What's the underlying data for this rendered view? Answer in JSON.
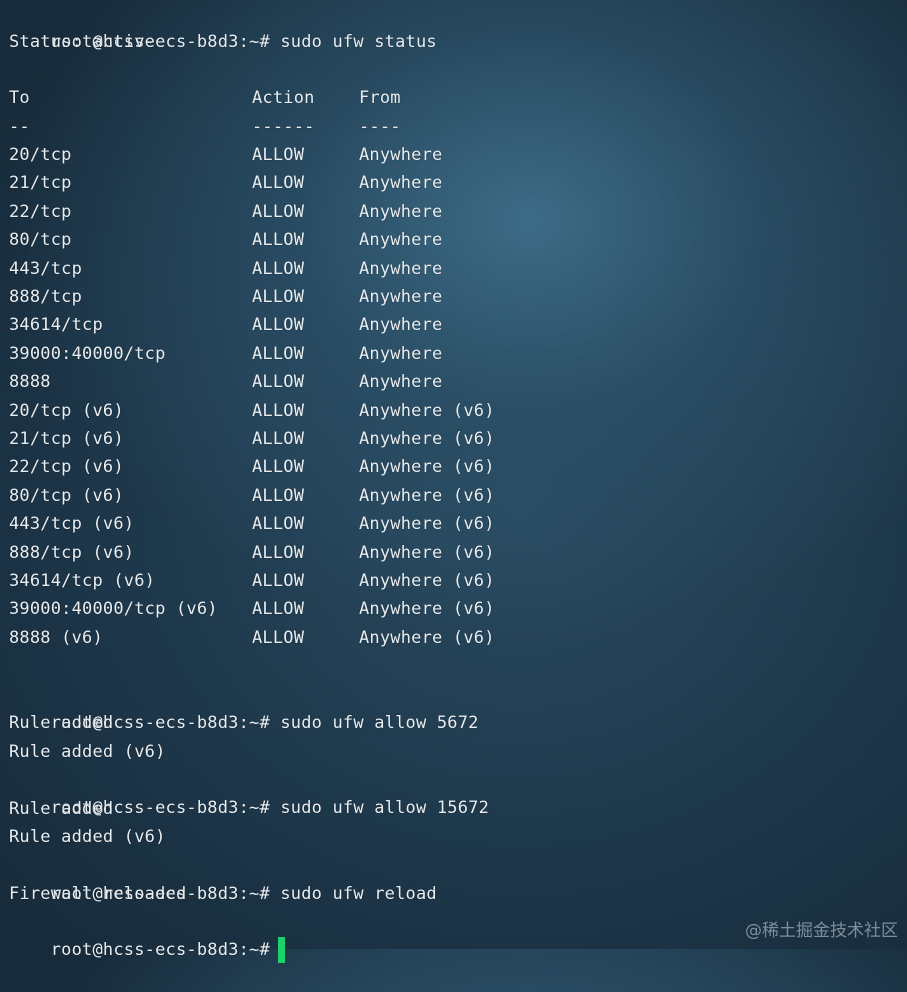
{
  "terminal": {
    "prompt": "root@hcss-ecs-b8d3:~#",
    "cmd_status": "sudo ufw status",
    "status_line": "Status: active",
    "header": {
      "to": "To",
      "action": "Action",
      "from": "From"
    },
    "separator": {
      "to": "--",
      "action": "------",
      "from": "----"
    },
    "rules": [
      {
        "to": "20/tcp",
        "action": "ALLOW",
        "from": "Anywhere"
      },
      {
        "to": "21/tcp",
        "action": "ALLOW",
        "from": "Anywhere"
      },
      {
        "to": "22/tcp",
        "action": "ALLOW",
        "from": "Anywhere"
      },
      {
        "to": "80/tcp",
        "action": "ALLOW",
        "from": "Anywhere"
      },
      {
        "to": "443/tcp",
        "action": "ALLOW",
        "from": "Anywhere"
      },
      {
        "to": "888/tcp",
        "action": "ALLOW",
        "from": "Anywhere"
      },
      {
        "to": "34614/tcp",
        "action": "ALLOW",
        "from": "Anywhere"
      },
      {
        "to": "39000:40000/tcp",
        "action": "ALLOW",
        "from": "Anywhere"
      },
      {
        "to": "8888",
        "action": "ALLOW",
        "from": "Anywhere"
      },
      {
        "to": "20/tcp (v6)",
        "action": "ALLOW",
        "from": "Anywhere (v6)"
      },
      {
        "to": "21/tcp (v6)",
        "action": "ALLOW",
        "from": "Anywhere (v6)"
      },
      {
        "to": "22/tcp (v6)",
        "action": "ALLOW",
        "from": "Anywhere (v6)"
      },
      {
        "to": "80/tcp (v6)",
        "action": "ALLOW",
        "from": "Anywhere (v6)"
      },
      {
        "to": "443/tcp (v6)",
        "action": "ALLOW",
        "from": "Anywhere (v6)"
      },
      {
        "to": "888/tcp (v6)",
        "action": "ALLOW",
        "from": "Anywhere (v6)"
      },
      {
        "to": "34614/tcp (v6)",
        "action": "ALLOW",
        "from": "Anywhere (v6)"
      },
      {
        "to": "39000:40000/tcp (v6)",
        "action": "ALLOW",
        "from": "Anywhere (v6)"
      },
      {
        "to": "8888 (v6)",
        "action": "ALLOW",
        "from": "Anywhere (v6)"
      }
    ],
    "cmd_allow_1": "sudo ufw allow 5672",
    "out_allow_1a": "Rule added",
    "out_allow_1b": "Rule added (v6)",
    "cmd_allow_2": "sudo ufw allow 15672",
    "out_allow_2a": "Rule added",
    "out_allow_2b": "Rule added (v6)",
    "cmd_reload": "sudo ufw reload",
    "out_reload": "Firewall reloaded",
    "cursor_color": "#19d36a"
  },
  "watermark": "@稀土掘金技术社区"
}
